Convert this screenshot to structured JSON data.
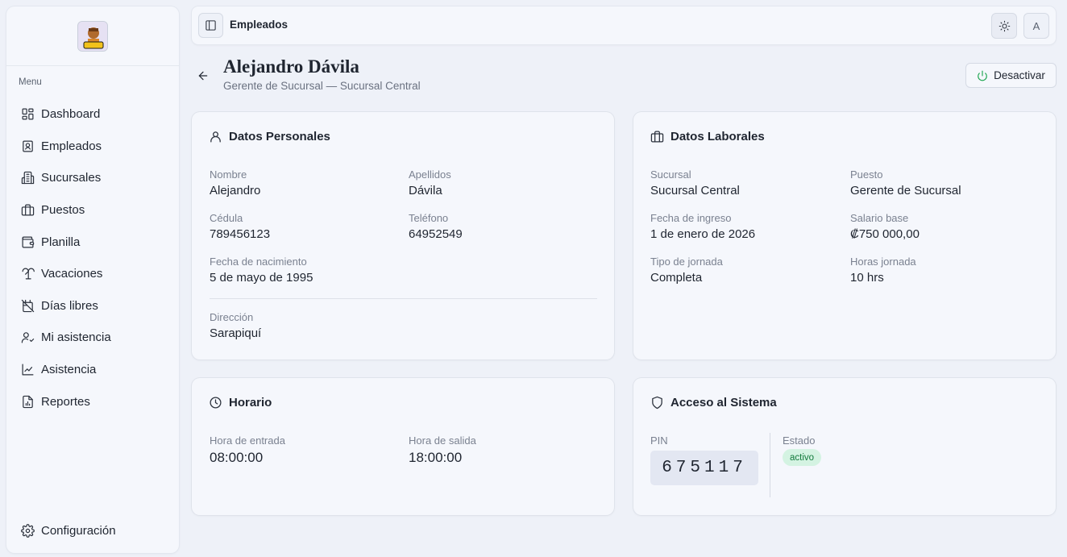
{
  "sidebar": {
    "menu_label": "Menu",
    "items": [
      {
        "label": "Dashboard",
        "icon": "dashboard-icon"
      },
      {
        "label": "Empleados",
        "icon": "employee-badge-icon"
      },
      {
        "label": "Sucursales",
        "icon": "building-icon"
      },
      {
        "label": "Puestos",
        "icon": "briefcase-icon"
      },
      {
        "label": "Planilla",
        "icon": "wallet-icon"
      },
      {
        "label": "Vacaciones",
        "icon": "palm-tree-icon"
      },
      {
        "label": "Días libres",
        "icon": "calendar-off-icon"
      },
      {
        "label": "Mi asistencia",
        "icon": "user-check-icon"
      },
      {
        "label": "Asistencia",
        "icon": "chart-line-icon"
      },
      {
        "label": "Reportes",
        "icon": "file-chart-icon"
      }
    ],
    "config_label": "Configuración"
  },
  "topbar": {
    "title": "Empleados",
    "avatar_initial": "A"
  },
  "header": {
    "name": "Alejandro Dávila",
    "subtitle": "Gerente de Sucursal — Sucursal Central",
    "deactivate_label": "Desactivar"
  },
  "personal": {
    "title": "Datos Personales",
    "nombre_label": "Nombre",
    "nombre": "Alejandro",
    "apellidos_label": "Apellidos",
    "apellidos": "Dávila",
    "cedula_label": "Cédula",
    "cedula": "789456123",
    "telefono_label": "Teléfono",
    "telefono": "64952549",
    "nacimiento_label": "Fecha de nacimiento",
    "nacimiento": "5 de mayo de 1995",
    "direccion_label": "Dirección",
    "direccion": "Sarapiquí"
  },
  "laboral": {
    "title": "Datos Laborales",
    "sucursal_label": "Sucursal",
    "sucursal": "Sucursal Central",
    "puesto_label": "Puesto",
    "puesto": "Gerente de Sucursal",
    "ingreso_label": "Fecha de ingreso",
    "ingreso": "1 de enero de 2026",
    "salario_label": "Salario base",
    "salario": "₡750 000,00",
    "jornada_label": "Tipo de jornada",
    "jornada": "Completa",
    "horas_label": "Horas jornada",
    "horas": "10 hrs"
  },
  "horario": {
    "title": "Horario",
    "entrada_label": "Hora de entrada",
    "entrada": "08:00:00",
    "salida_label": "Hora de salida",
    "salida": "18:00:00"
  },
  "acceso": {
    "title": "Acceso al Sistema",
    "pin_label": "PIN",
    "pin": "675117",
    "estado_label": "Estado",
    "estado": "activo"
  },
  "colors": {
    "background": "#eef1f8",
    "card": "#f5f7fc",
    "accent_green": "#16a34a",
    "badge_bg": "#d4f3e2"
  }
}
